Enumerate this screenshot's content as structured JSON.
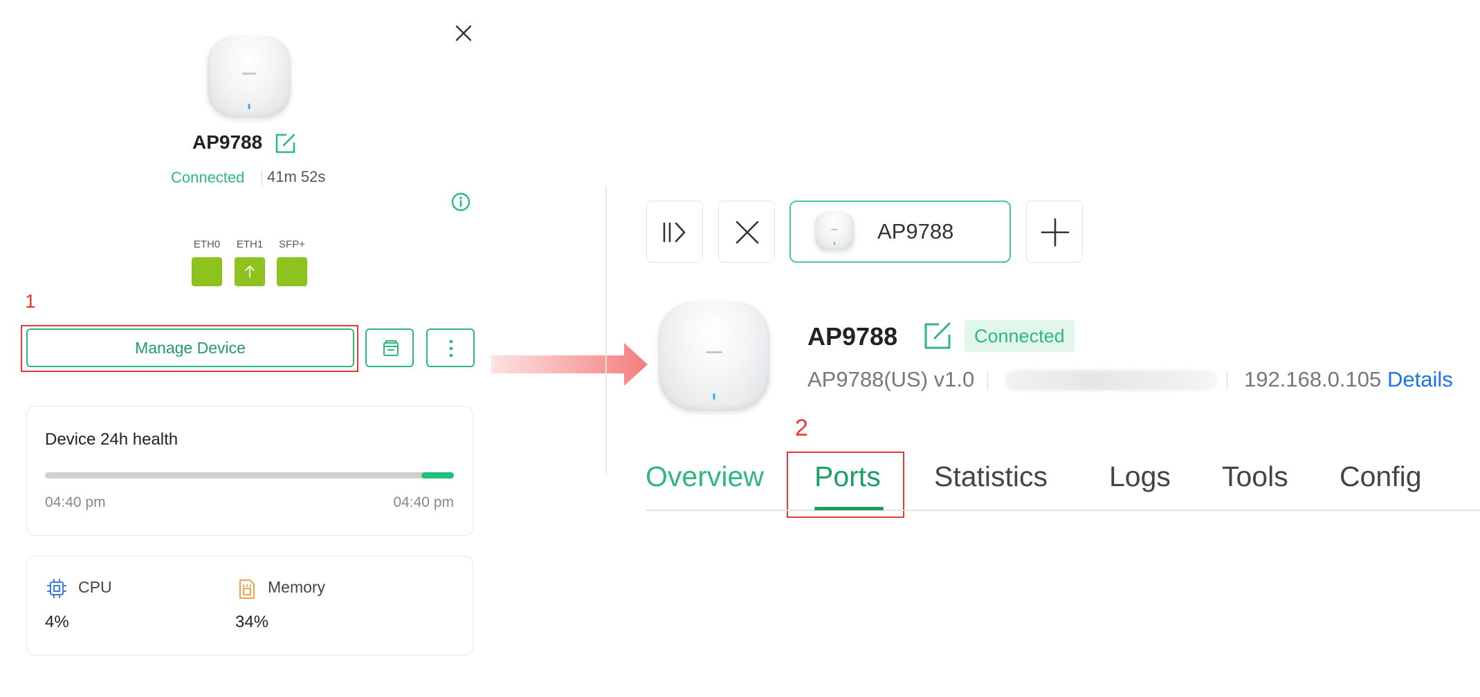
{
  "left_panel": {
    "device_name": "AP9788",
    "status": "Connected",
    "uptime": "41m 52s",
    "ports": [
      {
        "label": "ETH0",
        "state": "up"
      },
      {
        "label": "ETH1",
        "state": "uplink"
      },
      {
        "label": "SFP+",
        "state": "up"
      }
    ],
    "annotation_number": "1",
    "manage_button_label": "Manage Device",
    "health": {
      "title": "Device 24h health",
      "start_time": "04:40 pm",
      "end_time": "04:40 pm",
      "healthy_fraction": 0.08
    },
    "resources": {
      "cpu_label": "CPU",
      "cpu_value": "4%",
      "memory_label": "Memory",
      "memory_value": "34%"
    }
  },
  "right_panel": {
    "tab_chip_label": "AP9788",
    "device_name": "AP9788",
    "status_badge": "Connected",
    "model": "AP9788(US) v1.0",
    "ip_address": "192.168.0.105",
    "details_link": "Details",
    "annotation_number": "2",
    "tabs": [
      "Overview",
      "Ports",
      "Statistics",
      "Logs",
      "Tools",
      "Config"
    ],
    "active_tab": "Ports"
  },
  "colors": {
    "accent_green": "#2db87c",
    "port_green": "#8dc21f",
    "link_blue": "#1a73e8",
    "highlight_red": "#e53935"
  }
}
